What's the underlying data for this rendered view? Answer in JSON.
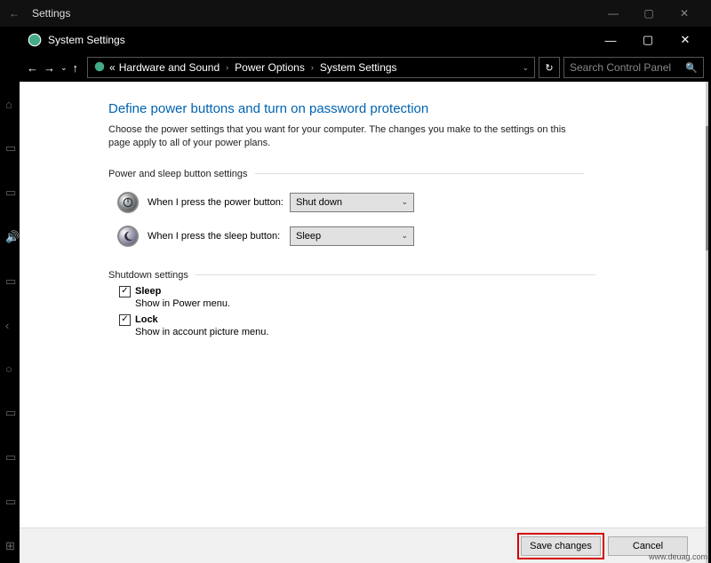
{
  "outer": {
    "title": "Settings",
    "min": "—",
    "max": "▢",
    "close": "✕"
  },
  "inner": {
    "title": "System Settings",
    "min": "—",
    "max": "▢",
    "close": "✕"
  },
  "nav": {
    "crumb_prefix": "«",
    "crumb1": "Hardware and Sound",
    "crumb2": "Power Options",
    "crumb3": "System Settings",
    "search_placeholder": "Search Control Panel"
  },
  "page": {
    "title": "Define power buttons and turn on password protection",
    "desc": "Choose the power settings that you want for your computer. The changes you make to the settings on this page apply to all of your power plans.",
    "section1": "Power and sleep button settings",
    "power_label": "When I press the power button:",
    "power_value": "Shut down",
    "sleep_label": "When I press the sleep button:",
    "sleep_value": "Sleep",
    "section2": "Shutdown settings",
    "chk_sleep_title": "Sleep",
    "chk_sleep_desc": "Show in Power menu.",
    "chk_lock_title": "Lock",
    "chk_lock_desc": "Show in account picture menu."
  },
  "footer": {
    "save": "Save changes",
    "cancel": "Cancel"
  },
  "watermark": "www.deuag.com"
}
